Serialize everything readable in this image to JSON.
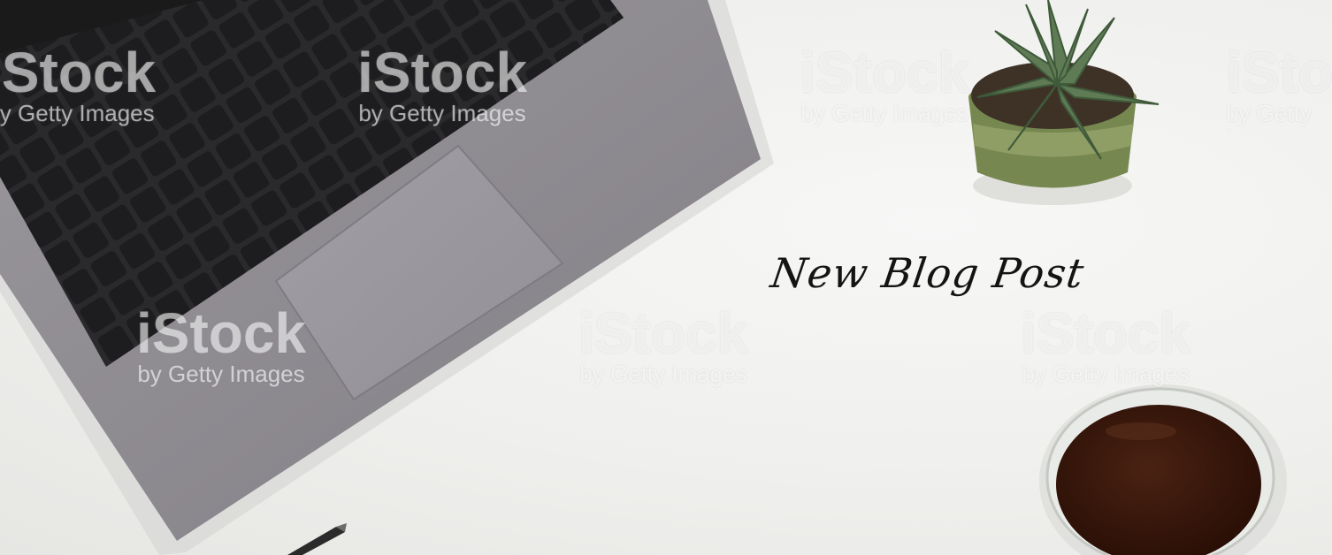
{
  "headline": "New Blog Post",
  "watermark": {
    "brand": "iStock",
    "sub": "by Getty Images"
  },
  "objects": [
    {
      "name": "laptop",
      "color": "#8e8a8f"
    },
    {
      "name": "succulent-plant",
      "color": "#5e7a55"
    },
    {
      "name": "coffee-cup",
      "color": "#3a1a0d"
    },
    {
      "name": "pen",
      "color": "#2b2b2b"
    }
  ]
}
